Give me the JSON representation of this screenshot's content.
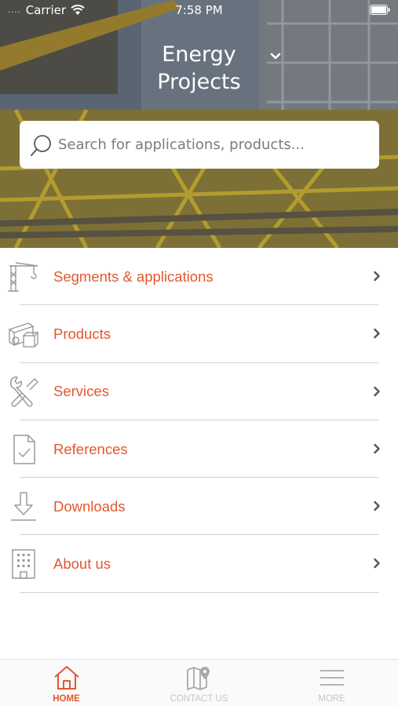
{
  "status_bar": {
    "signal_dots": "....",
    "carrier": "Carrier",
    "time": "7:58 PM",
    "wifi_icon": "wifi-icon",
    "battery_icon": "battery-icon"
  },
  "header": {
    "title_line1": "Energy",
    "title_line2": "Projects",
    "dropdown_icon": "chevron-down-icon"
  },
  "search": {
    "placeholder": "Search for applications, products...",
    "icon": "search-icon"
  },
  "menu": {
    "items": [
      {
        "label": "Segments & applications",
        "icon": "crane-icon"
      },
      {
        "label": "Products",
        "icon": "products-icon"
      },
      {
        "label": "Services",
        "icon": "tools-icon"
      },
      {
        "label": "References",
        "icon": "document-check-icon"
      },
      {
        "label": "Downloads",
        "icon": "download-icon"
      },
      {
        "label": "About us",
        "icon": "building-icon"
      }
    ]
  },
  "tab_bar": {
    "tabs": [
      {
        "label": "HOME",
        "icon": "home-icon",
        "active": true
      },
      {
        "label": "CONTACT US",
        "icon": "map-pin-icon",
        "active": false
      },
      {
        "label": "MORE",
        "icon": "hamburger-menu-icon",
        "active": false
      }
    ]
  },
  "colors": {
    "accent": "#e4572e",
    "icon_gray": "#9a9a9a",
    "separator": "#d2d2d2",
    "tab_inactive": "#c6c6c6"
  }
}
